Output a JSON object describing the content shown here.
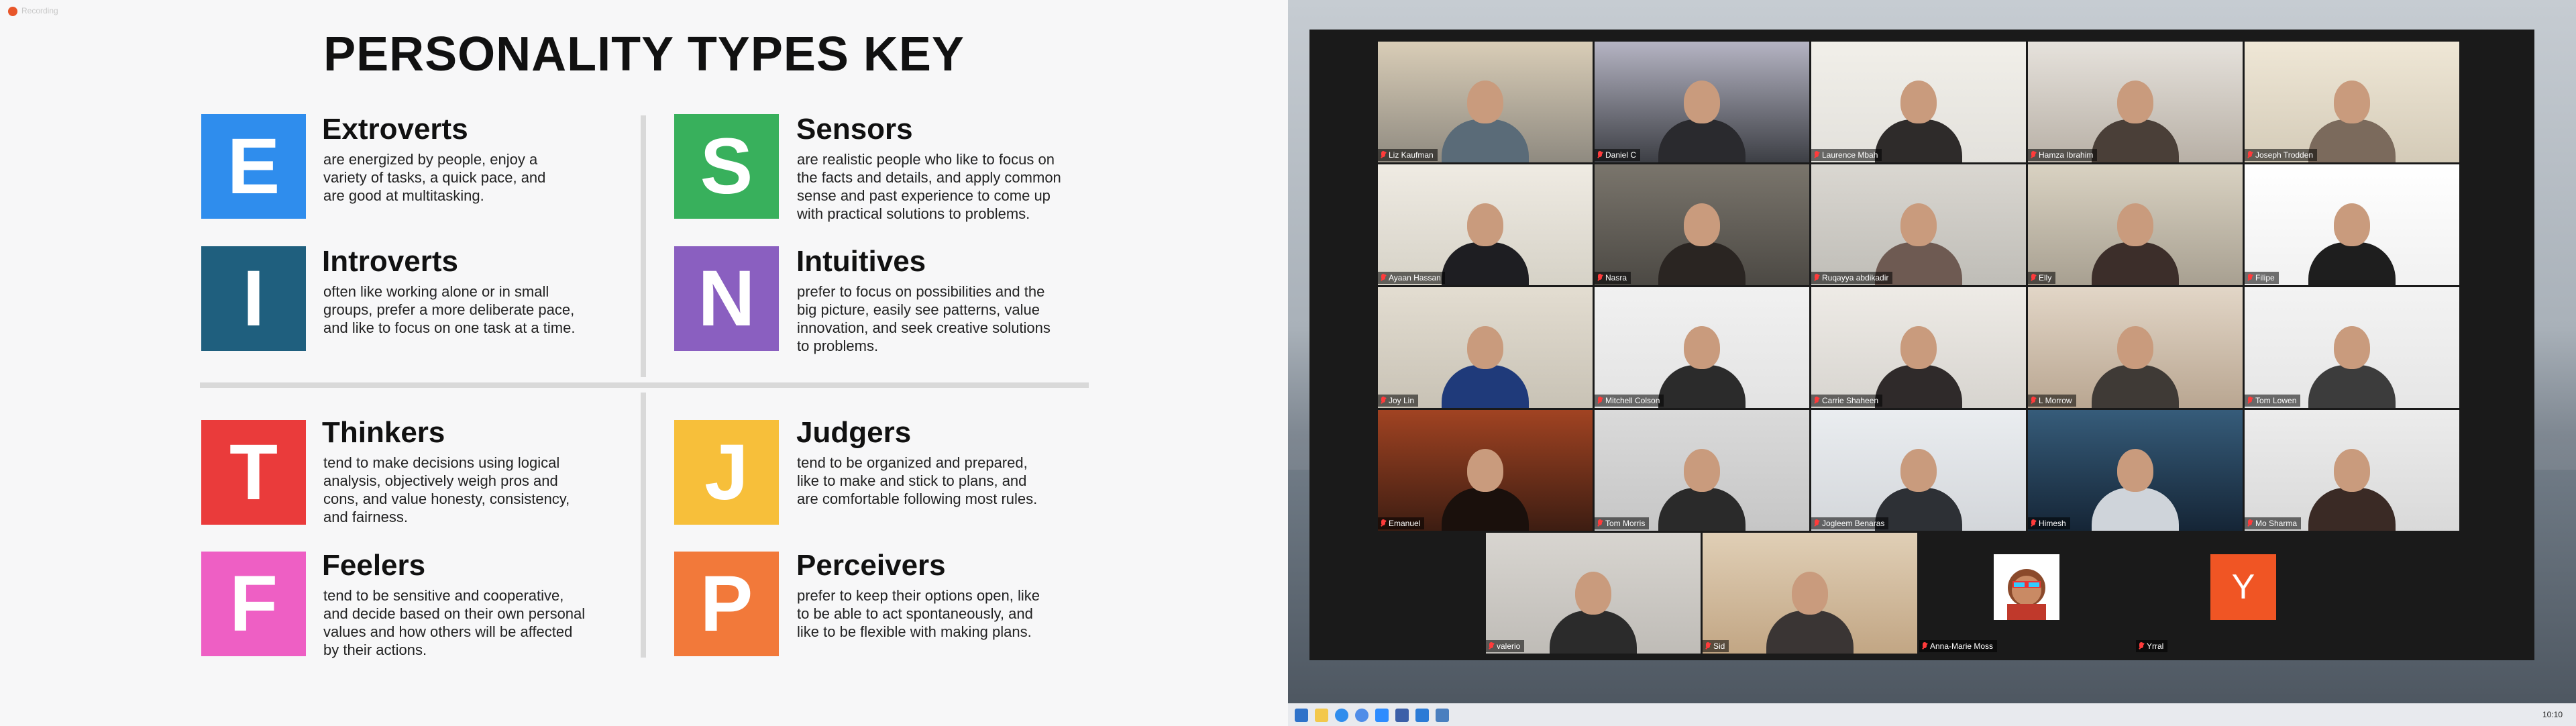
{
  "recording": {
    "label": "Recording"
  },
  "slide": {
    "title": "PERSONALITY TYPES KEY",
    "types": [
      {
        "letter": "E",
        "name": "Extroverts",
        "color": "#2f8ded",
        "lines": [
          "are energized by people, enjoy a",
          "variety of tasks, a quick pace, and",
          "are good at multitasking."
        ]
      },
      {
        "letter": "I",
        "name": "Introverts",
        "color": "#1f5f7e",
        "lines": [
          "often like working alone or in small",
          "groups, prefer a more deliberate pace,",
          "and like to focus on one task at a time."
        ]
      },
      {
        "letter": "S",
        "name": "Sensors",
        "color": "#38b05c",
        "lines": [
          "are realistic people who like to focus on",
          "the facts and details, and apply common",
          "sense and past experience to come up",
          "with practical solutions to problems."
        ]
      },
      {
        "letter": "N",
        "name": "Intuitives",
        "color": "#8a5fc0",
        "lines": [
          "prefer to focus on possibilities and the",
          "big picture, easily see patterns, value",
          "innovation, and seek creative solutions",
          "to problems."
        ]
      },
      {
        "letter": "T",
        "name": "Thinkers",
        "color": "#ea3b3b",
        "lines": [
          "tend to make decisions using logical",
          "analysis, objectively weigh pros and",
          "cons, and value honesty, consistency,",
          "and fairness."
        ]
      },
      {
        "letter": "F",
        "name": "Feelers",
        "color": "#ee5fc4",
        "lines": [
          "tend to be sensitive and cooperative,",
          "and decide based on their own personal",
          "values and how others will be affected",
          "by their actions."
        ]
      },
      {
        "letter": "J",
        "name": "Judgers",
        "color": "#f7bf3a",
        "lines": [
          "tend to be organized and prepared,",
          "like to make and stick to plans, and",
          "are comfortable following most rules."
        ]
      },
      {
        "letter": "P",
        "name": "Perceivers",
        "color": "#f2793a",
        "lines": [
          "prefer to keep their options open, like",
          "to be able to act spontaneously, and",
          "like to be flexible with making plans."
        ]
      }
    ]
  },
  "participants": [
    "Liz Kaufman",
    "Daniel C",
    "Laurence Mbah",
    "Hamza Ibrahim",
    "Joseph Trodden",
    "Ayaan Hassan",
    "Nasra",
    "Ruqayya abdikadir",
    "Elly",
    "Filipe",
    "Joy Lin",
    "Mitchell Colson",
    "Carrie Shaheen",
    "L Morrow",
    "Tom Lowen",
    "Emanuel",
    "Tom Morris",
    "Jogleem Benaras",
    "Himesh",
    "Mo Sharma",
    "valerio",
    "Sid",
    "Anna-Marie Moss",
    "Yrral"
  ],
  "avatar_initial": "Y",
  "taskbar": {
    "clock": "10:10"
  }
}
